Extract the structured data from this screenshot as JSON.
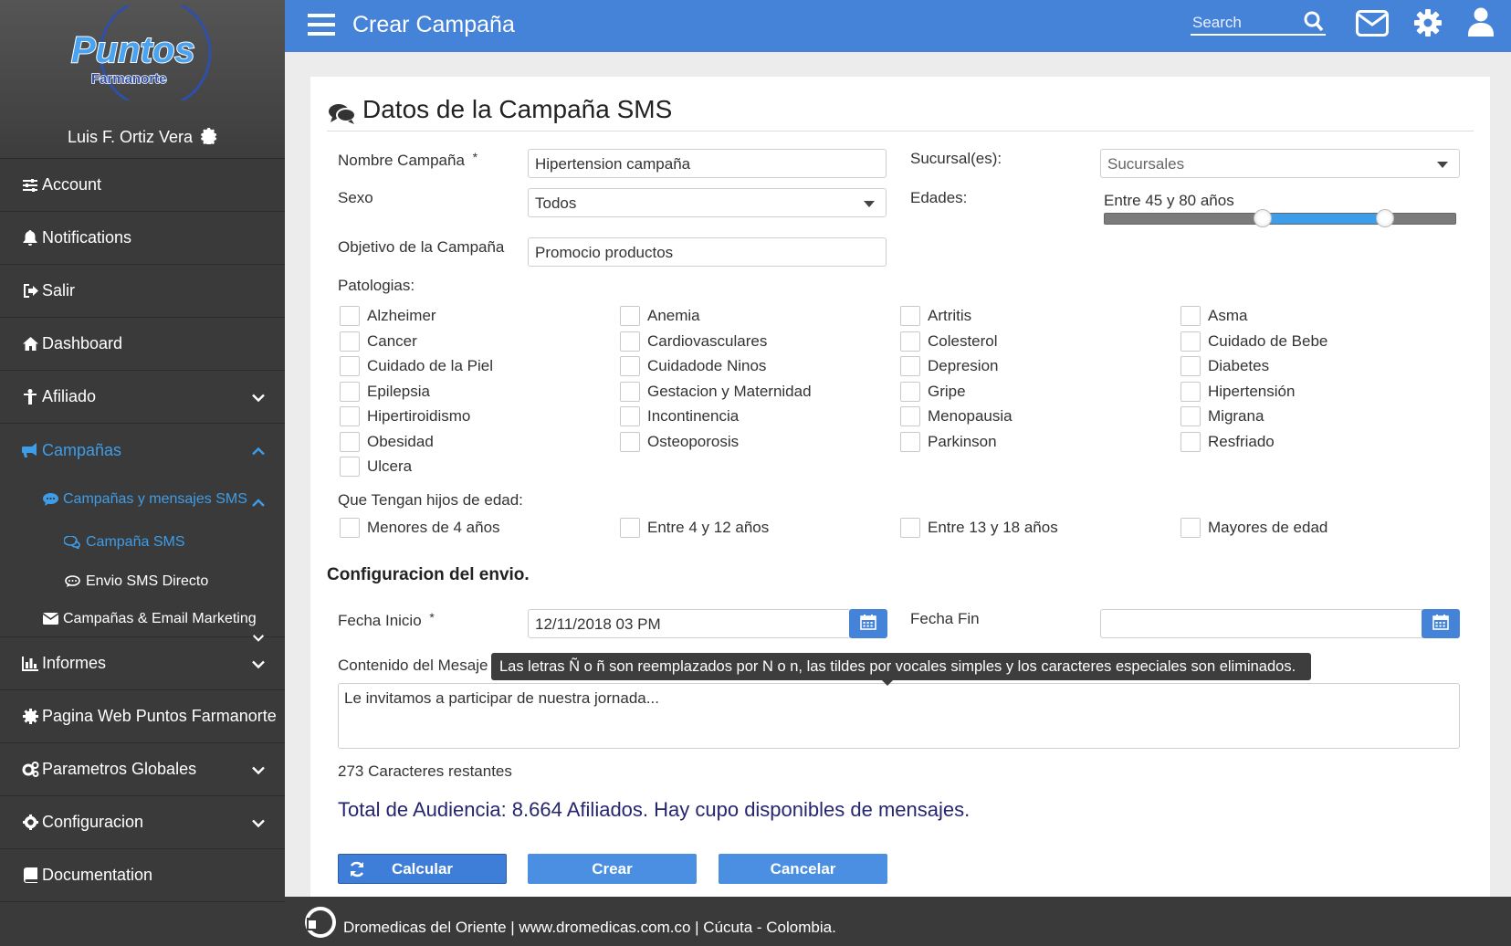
{
  "brand": {
    "logo_main": "Puntos",
    "logo_sub": "Farmanorte",
    "user": "Luis F. Ortiz Vera"
  },
  "sidebar": {
    "account": "Account",
    "notifications": "Notifications",
    "salir": "Salir",
    "dashboard": "Dashboard",
    "afiliado": "Afiliado",
    "campanas": "Campañas",
    "camp_sms": "Campañas y mensajes SMS",
    "campana_sms": "Campaña SMS",
    "envio_sms": "Envio SMS Directo",
    "camp_email": "Campañas & Email Marketing",
    "informes": "Informes",
    "pagina_web": "Pagina Web Puntos Farmanorte",
    "parametros": "Parametros Globales",
    "configuracion": "Configuracion",
    "documentation": "Documentation"
  },
  "topbar": {
    "title": "Crear Campaña",
    "search": "Search"
  },
  "form": {
    "section_title": "Datos de la Campaña SMS",
    "nombre_label": "Nombre Campaña",
    "required": "*",
    "nombre_value": "Hipertension campaña",
    "sucursal_label": "Sucursal(es):",
    "sucursal_value": "Sucursales",
    "sexo_label": "Sexo",
    "sexo_value": "Todos",
    "edades_label": "Edades:",
    "edades_value": "Entre 45 y 80 años",
    "edad_min": 45,
    "edad_max": 80,
    "objetivo_label": "Objetivo de la Campaña",
    "objetivo_value": "Promocio productos",
    "patologias_label": "Patologias:",
    "patologias": [
      "Alzheimer",
      "Anemia",
      "Artritis",
      "Asma",
      "Cancer",
      "Cardiovasculares",
      "Colesterol",
      "Cuidado de Bebe",
      "Cuidado de la Piel",
      "Cuidadode Ninos",
      "Depresion",
      "Diabetes",
      "Epilepsia",
      "Gestacion y Maternidad",
      "Gripe",
      "Hipertensión",
      "Hipertiroidismo",
      "Incontinencia",
      "Menopausia",
      "Migrana",
      "Obesidad",
      "Osteoporosis",
      "Parkinson",
      "Resfriado",
      "Ulcera"
    ],
    "hijos_label": "Que Tengan hijos de edad:",
    "hijos": [
      "Menores de 4 años",
      "Entre 4 y 12 años",
      "Entre 13 y 18 años",
      "Mayores de edad"
    ],
    "config_title": "Configuracion del envio.",
    "fecha_inicio_label": "Fecha Inicio",
    "fecha_inicio_value": "12/11/2018 03 PM",
    "fecha_fin_label": "Fecha Fin",
    "fecha_fin_value": "",
    "contenido_label": "Contenido del Mesaje",
    "tooltip": "Las letras Ñ o ñ son reemplazados por N o n, las tildes por vocales simples y los caracteres especiales son eliminados.",
    "mensaje": "Le invitamos a participar de nuestra jornada...",
    "restantes": "273 Caracteres restantes",
    "audiencia": "Total de Audiencia: 8.664 Afiliados. Hay cupo disponibles de mensajes.",
    "btn_calcular": "Calcular",
    "btn_crear": "Crear",
    "btn_cancelar": "Cancelar"
  },
  "footer": {
    "text": "Dromedicas del Oriente | www.dromedicas.com.co | Cúcuta - Colombia."
  }
}
